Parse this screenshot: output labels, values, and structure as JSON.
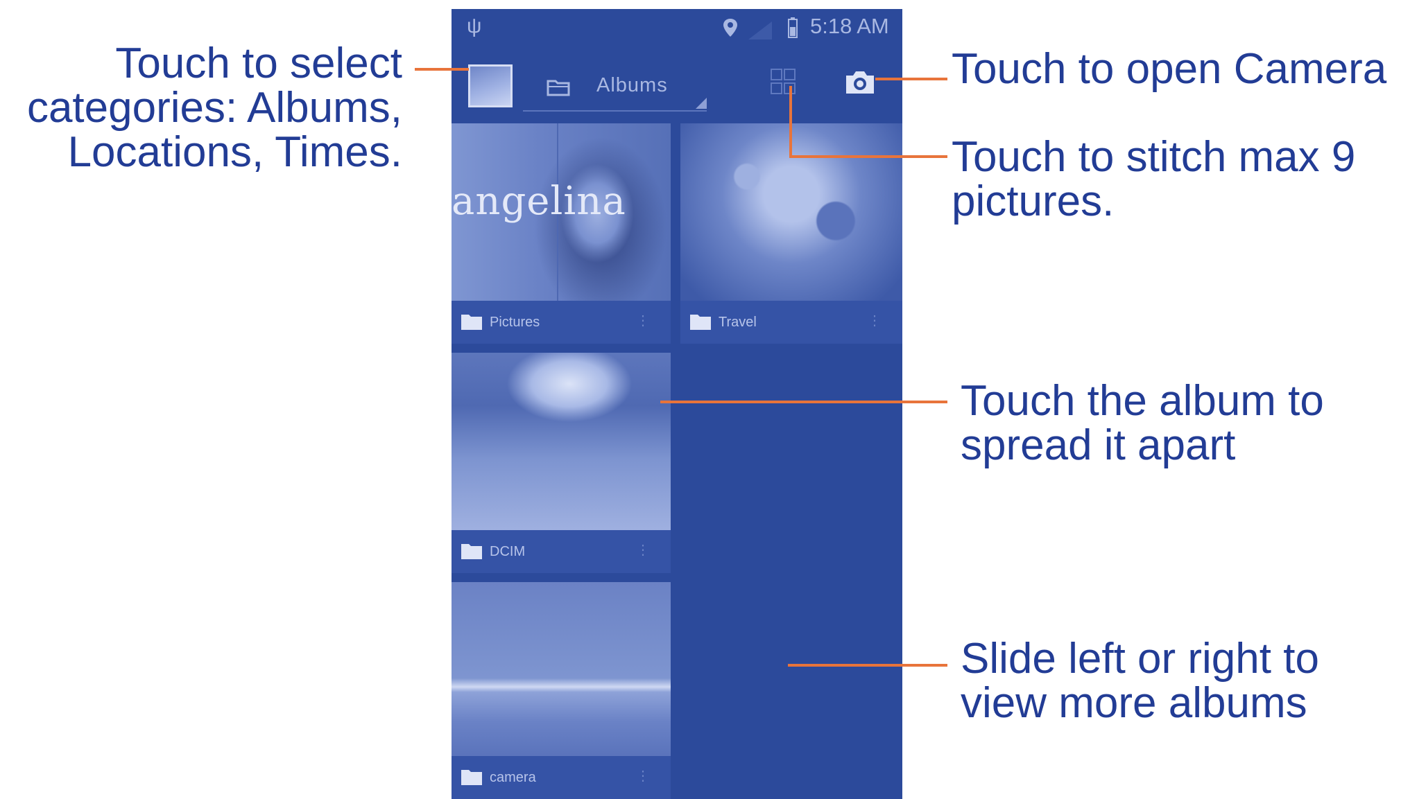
{
  "status_bar": {
    "usb_icon": "usb-icon",
    "location_icon": "location-pin-icon",
    "time": "5:18 AM"
  },
  "app_bar": {
    "category_label": "Albums",
    "stitch_icon": "stitch-grid-icon",
    "camera_icon": "camera-icon"
  },
  "albums": [
    {
      "label": "Pictures",
      "image_text": "angelina"
    },
    {
      "label": "Travel"
    },
    {
      "label": "DCIM"
    },
    {
      "label": "camera"
    }
  ],
  "annotations": {
    "categories": [
      "Touch to select",
      "categories: Albums,",
      "Locations, Times."
    ],
    "camera": [
      "Touch to open Camera"
    ],
    "stitch": [
      "Touch to stitch max 9",
      "pictures."
    ],
    "album": [
      "Touch the album to",
      "spread it apart"
    ],
    "slide": [
      "Slide left or right to",
      "view more albums"
    ]
  },
  "colors": {
    "phone_background": "#2c4a9b",
    "annotation_text": "#223c95",
    "leader_line": "#e8743b"
  }
}
